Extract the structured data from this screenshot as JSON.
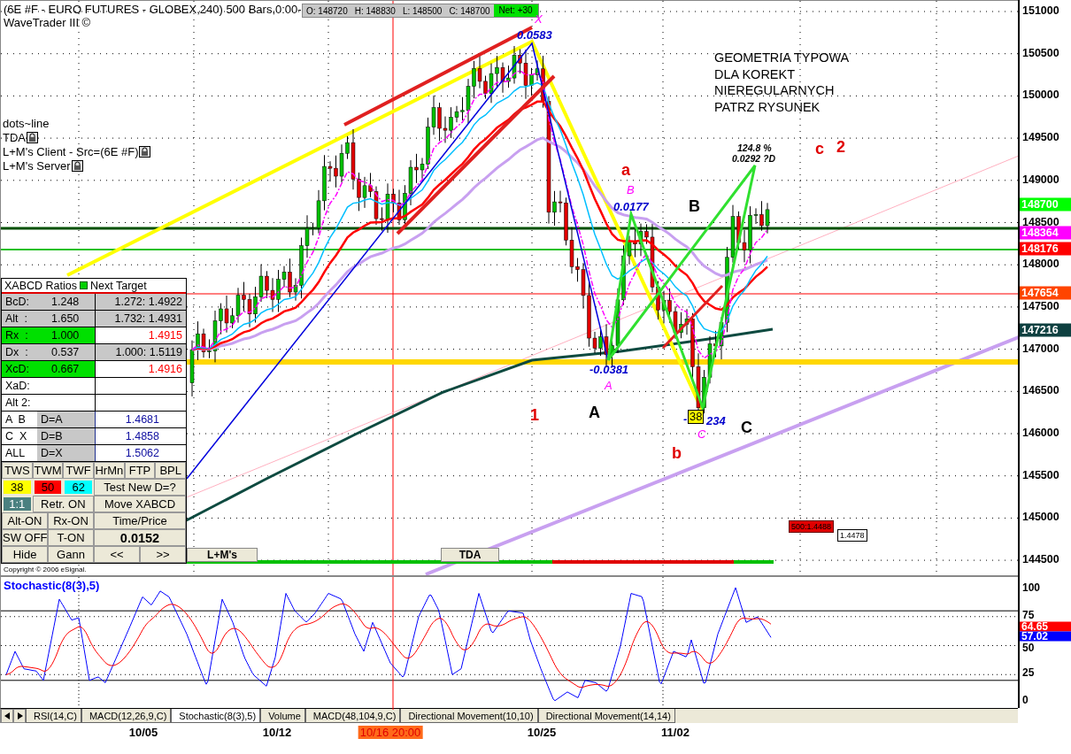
{
  "header": {
    "title": "(6E #F - EURO FUTURES - GLOBEX,240) 500 Bars,0:00-",
    "subtitle": "WaveTrader III ©"
  },
  "quote": {
    "open": "O: 148720",
    "high": "H: 148830",
    "low": "L: 148500",
    "close": "C: 148700",
    "net": "Net: +30"
  },
  "indicator_labels": [
    {
      "text": "dots~line",
      "locked": false
    },
    {
      "text": "TDA",
      "locked": true
    },
    {
      "text": "L+M's Client - Src=(6E #F)",
      "locked": true
    },
    {
      "text": "L+M's Server",
      "locked": true
    }
  ],
  "annotations": [
    {
      "kind": "point",
      "text": "X"
    },
    {
      "kind": "ratio",
      "text": "0.0583"
    },
    {
      "kind": "note",
      "text": "GEOMETRIA TYPOWA DLA KOREKT NIEREGULARNYCH PATRZ RYSUNEK"
    },
    {
      "kind": "projection",
      "text": "124.8 %"
    },
    {
      "kind": "projection",
      "text": "0.0292 ?D"
    },
    {
      "kind": "wave",
      "text": "c"
    },
    {
      "kind": "wave",
      "text": "2"
    },
    {
      "kind": "wave",
      "text": "a"
    },
    {
      "kind": "point",
      "text": "B"
    },
    {
      "kind": "ratio",
      "text": "0.0177"
    },
    {
      "kind": "leg",
      "text": "B"
    },
    {
      "kind": "ratio",
      "text": "-0.0381"
    },
    {
      "kind": "point",
      "text": "A"
    },
    {
      "kind": "wave",
      "text": "1"
    },
    {
      "kind": "leg",
      "text": "A"
    },
    {
      "kind": "ratio",
      "text": "-"
    },
    {
      "kind": "badge",
      "text": "38"
    },
    {
      "kind": "ratio",
      "text": "234"
    },
    {
      "kind": "point",
      "text": "C"
    },
    {
      "kind": "wave",
      "text": "b"
    },
    {
      "kind": "leg",
      "text": "C"
    }
  ],
  "panel": {
    "title": "XABCD Ratios",
    "target_heading": "Next Target",
    "ratios": [
      {
        "label": "BcD:",
        "value": "1.248",
        "target": "1.272: 1.4922",
        "kind": "computed"
      },
      {
        "label": "Alt  :",
        "value": "1.650",
        "target": "1.732: 1.4931",
        "kind": "computed"
      },
      {
        "label": "Rx  :",
        "value": "1.000",
        "target": "1.4915",
        "kind": "hit"
      },
      {
        "label": "Dx  :",
        "value": "0.537",
        "target": "1.000: 1.5119",
        "kind": "computed"
      },
      {
        "label": "XcD:",
        "value": "0.667",
        "target": "1.4916",
        "kind": "hit"
      },
      {
        "label": "XaD:",
        "kind": "empty"
      },
      {
        "label": "Alt 2:",
        "kind": "empty"
      }
    ],
    "d_rows": [
      {
        "label": "A  B",
        "condition": "D=A",
        "value": "1.4681"
      },
      {
        "label": "C  X",
        "condition": "D=B",
        "value": "1.4858"
      },
      {
        "label": "ALL",
        "condition": "D=X",
        "value": "1.5062"
      }
    ],
    "buttons": [
      [
        {
          "kind": "button",
          "label": "TWS"
        },
        {
          "kind": "button",
          "label": "TWM"
        },
        {
          "kind": "button",
          "label": "TWF"
        },
        {
          "kind": "button",
          "label": "HrMn"
        },
        {
          "kind": "button",
          "label": "FTP"
        },
        {
          "kind": "button",
          "label": "BPL"
        }
      ],
      [
        {
          "kind": "swatch",
          "label": "38",
          "color": "#ffff00"
        },
        {
          "kind": "swatch",
          "label": "50",
          "color": "#ff0000"
        },
        {
          "kind": "swatch",
          "label": "62",
          "color": "#00ffff"
        },
        {
          "kind": "button",
          "label": "Test New D=?"
        }
      ],
      [
        {
          "kind": "swatch",
          "label": "1:1",
          "color": "#4a8080"
        },
        {
          "kind": "button",
          "label": "Retr. ON"
        },
        {
          "kind": "button",
          "label": "Move XABCD"
        }
      ],
      [
        {
          "kind": "button",
          "label": "Alt-ON"
        },
        {
          "kind": "button",
          "label": "Rx-ON"
        },
        {
          "kind": "button",
          "label": "Time/Price"
        }
      ],
      [
        {
          "kind": "button",
          "label": "SW OFF"
        },
        {
          "kind": "button",
          "label": "T-ON"
        },
        {
          "kind": "readout",
          "label": "0.0152"
        }
      ],
      [
        {
          "kind": "button",
          "label": "Hide"
        },
        {
          "kind": "button",
          "label": "Gann"
        },
        {
          "kind": "button",
          "label": "<<"
        },
        {
          "kind": "button",
          "label": ">>"
        }
      ]
    ]
  },
  "chart_tabs": [
    "L+M's",
    "TDA"
  ],
  "target_boxes": [
    {
      "kind": "alert",
      "text": "500:1.4488"
    },
    {
      "kind": "plain",
      "text": "1.4478"
    }
  ],
  "copyright": "Copyright © 2006 eSignal.",
  "price_axis": [
    "151000",
    "150500",
    "150000",
    "149500",
    "149000",
    "148500",
    "148000",
    "147500",
    "147000",
    "146500",
    "146000",
    "145500",
    "145000",
    "144500"
  ],
  "price_markers": [
    {
      "text": "148700",
      "color": "#00ff00"
    },
    {
      "text": "148364",
      "color": "#ff00ff"
    },
    {
      "text": "148176",
      "color": "#ff0000"
    },
    {
      "text": "147654",
      "color": "#ff4500"
    },
    {
      "text": "147216",
      "color": "#0e4040"
    }
  ],
  "stochastic": {
    "title": "Stochastic(8(3),5)",
    "axis": [
      "100",
      "75",
      "50",
      "25",
      "0"
    ],
    "markers": [
      {
        "text": "64.65",
        "color": "#ff0000"
      },
      {
        "text": "57.02",
        "color": "#0000ff"
      }
    ]
  },
  "tabs": [
    {
      "label": "RSI(14,C)",
      "selected": false
    },
    {
      "label": "MACD(12,26,9,C)",
      "selected": false
    },
    {
      "label": "Stochastic(8(3),5)",
      "selected": true
    },
    {
      "label": "Volume",
      "selected": false
    },
    {
      "label": "MACD(48,104,9,C)",
      "selected": false
    },
    {
      "label": "Directional Movement(10,10)",
      "selected": false
    },
    {
      "label": "Directional Movement(14,14)",
      "selected": false
    }
  ],
  "date_axis": [
    {
      "text": "10/05",
      "highlighted": false
    },
    {
      "text": "10/12",
      "highlighted": false
    },
    {
      "text": "10/16 20:00",
      "highlighted": true
    },
    {
      "text": "10/25",
      "highlighted": false
    },
    {
      "text": "11/02",
      "highlighted": false
    }
  ]
}
